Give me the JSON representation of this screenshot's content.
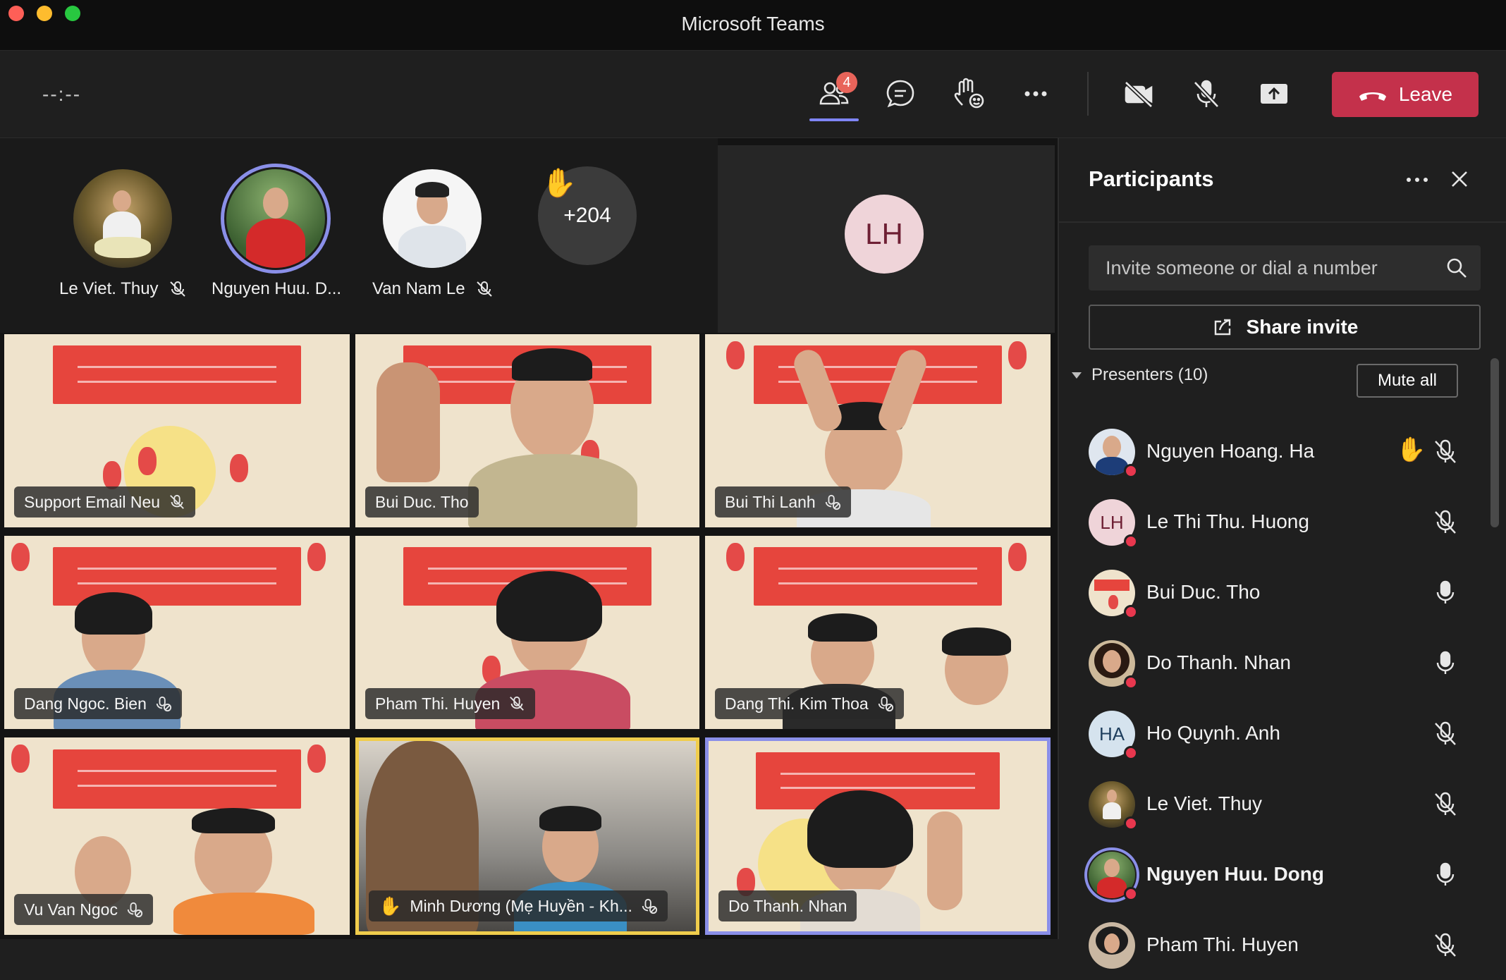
{
  "window": {
    "title": "Microsoft Teams"
  },
  "toolbar": {
    "timer": "--:--",
    "participants_badge": "4",
    "leave_label": "Leave"
  },
  "avatars_row": [
    {
      "name": "Le Viet. Thuy",
      "muted": true
    },
    {
      "name": "Nguyen Huu. D...",
      "muted": false,
      "speaking": true
    },
    {
      "name": "Van Nam Le",
      "muted": true
    }
  ],
  "overflow_count": "+204",
  "spotlight_initials": "LH",
  "video_tiles": [
    {
      "name": "Support Email Neu",
      "mic": "muted"
    },
    {
      "name": "Bui Duc. Tho",
      "mic": "none"
    },
    {
      "name": "Bui Thi Lanh",
      "mic": "pinned-muted"
    },
    {
      "name": "Dang Ngoc. Bien",
      "mic": "pinned-muted"
    },
    {
      "name": "Pham Thi. Huyen",
      "mic": "muted"
    },
    {
      "name": "Dang Thi. Kim Thoa",
      "mic": "pinned-muted"
    },
    {
      "name": "Vu Van Ngoc",
      "mic": "pinned-muted"
    },
    {
      "name": "Minh Dương (Mẹ Huyền - Kh...",
      "mic": "pinned-muted",
      "hand_raised": true,
      "highlight": "yellow"
    },
    {
      "name": "Do Thanh. Nhan",
      "mic": "none",
      "highlight": "purple"
    }
  ],
  "panel": {
    "title": "Participants",
    "invite_placeholder": "Invite someone or dial a number",
    "share_label": "Share invite",
    "presenters_label": "Presenters (10)",
    "mute_all_label": "Mute all",
    "participants": [
      {
        "name": "Nguyen Hoang. Ha",
        "mic": "muted",
        "hand": true
      },
      {
        "name": "Le Thi Thu. Huong",
        "initials": "LH",
        "mic": "muted"
      },
      {
        "name": "Bui Duc. Tho",
        "mic": "on"
      },
      {
        "name": "Do Thanh. Nhan",
        "mic": "on"
      },
      {
        "name": "Ho Quynh. Anh",
        "initials": "HA",
        "mic": "muted"
      },
      {
        "name": "Le Viet. Thuy",
        "mic": "muted"
      },
      {
        "name": "Nguyen Huu. Dong",
        "mic": "on",
        "speaking": true
      },
      {
        "name": "Pham Thi. Huyen",
        "mic": "muted"
      }
    ]
  },
  "colors": {
    "accent": "#7f85f5",
    "leave": "#c4314b",
    "highlight_yellow": "#f0cd4c",
    "status_red": "#e8374e"
  }
}
